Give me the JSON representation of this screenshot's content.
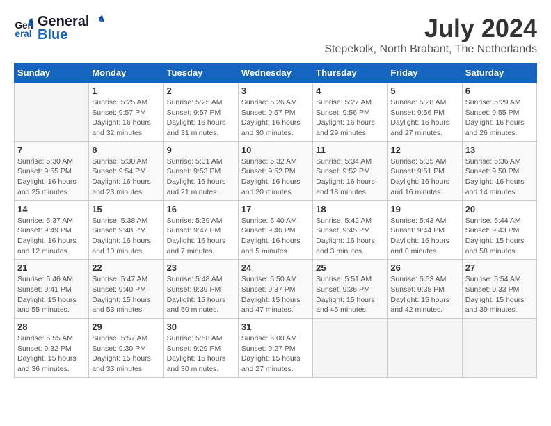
{
  "logo": {
    "text_general": "General",
    "text_blue": "Blue"
  },
  "header": {
    "month_year": "July 2024",
    "location": "Stepekolk, North Brabant, The Netherlands"
  },
  "weekdays": [
    "Sunday",
    "Monday",
    "Tuesday",
    "Wednesday",
    "Thursday",
    "Friday",
    "Saturday"
  ],
  "weeks": [
    [
      {
        "day": "",
        "sunrise": "",
        "sunset": "",
        "daylight": ""
      },
      {
        "day": "1",
        "sunrise": "Sunrise: 5:25 AM",
        "sunset": "Sunset: 9:57 PM",
        "daylight": "Daylight: 16 hours and 32 minutes."
      },
      {
        "day": "2",
        "sunrise": "Sunrise: 5:25 AM",
        "sunset": "Sunset: 9:57 PM",
        "daylight": "Daylight: 16 hours and 31 minutes."
      },
      {
        "day": "3",
        "sunrise": "Sunrise: 5:26 AM",
        "sunset": "Sunset: 9:57 PM",
        "daylight": "Daylight: 16 hours and 30 minutes."
      },
      {
        "day": "4",
        "sunrise": "Sunrise: 5:27 AM",
        "sunset": "Sunset: 9:56 PM",
        "daylight": "Daylight: 16 hours and 29 minutes."
      },
      {
        "day": "5",
        "sunrise": "Sunrise: 5:28 AM",
        "sunset": "Sunset: 9:56 PM",
        "daylight": "Daylight: 16 hours and 27 minutes."
      },
      {
        "day": "6",
        "sunrise": "Sunrise: 5:29 AM",
        "sunset": "Sunset: 9:55 PM",
        "daylight": "Daylight: 16 hours and 26 minutes."
      }
    ],
    [
      {
        "day": "7",
        "sunrise": "Sunrise: 5:30 AM",
        "sunset": "Sunset: 9:55 PM",
        "daylight": "Daylight: 16 hours and 25 minutes."
      },
      {
        "day": "8",
        "sunrise": "Sunrise: 5:30 AM",
        "sunset": "Sunset: 9:54 PM",
        "daylight": "Daylight: 16 hours and 23 minutes."
      },
      {
        "day": "9",
        "sunrise": "Sunrise: 5:31 AM",
        "sunset": "Sunset: 9:53 PM",
        "daylight": "Daylight: 16 hours and 21 minutes."
      },
      {
        "day": "10",
        "sunrise": "Sunrise: 5:32 AM",
        "sunset": "Sunset: 9:52 PM",
        "daylight": "Daylight: 16 hours and 20 minutes."
      },
      {
        "day": "11",
        "sunrise": "Sunrise: 5:34 AM",
        "sunset": "Sunset: 9:52 PM",
        "daylight": "Daylight: 16 hours and 18 minutes."
      },
      {
        "day": "12",
        "sunrise": "Sunrise: 5:35 AM",
        "sunset": "Sunset: 9:51 PM",
        "daylight": "Daylight: 16 hours and 16 minutes."
      },
      {
        "day": "13",
        "sunrise": "Sunrise: 5:36 AM",
        "sunset": "Sunset: 9:50 PM",
        "daylight": "Daylight: 16 hours and 14 minutes."
      }
    ],
    [
      {
        "day": "14",
        "sunrise": "Sunrise: 5:37 AM",
        "sunset": "Sunset: 9:49 PM",
        "daylight": "Daylight: 16 hours and 12 minutes."
      },
      {
        "day": "15",
        "sunrise": "Sunrise: 5:38 AM",
        "sunset": "Sunset: 9:48 PM",
        "daylight": "Daylight: 16 hours and 10 minutes."
      },
      {
        "day": "16",
        "sunrise": "Sunrise: 5:39 AM",
        "sunset": "Sunset: 9:47 PM",
        "daylight": "Daylight: 16 hours and 7 minutes."
      },
      {
        "day": "17",
        "sunrise": "Sunrise: 5:40 AM",
        "sunset": "Sunset: 9:46 PM",
        "daylight": "Daylight: 16 hours and 5 minutes."
      },
      {
        "day": "18",
        "sunrise": "Sunrise: 5:42 AM",
        "sunset": "Sunset: 9:45 PM",
        "daylight": "Daylight: 16 hours and 3 minutes."
      },
      {
        "day": "19",
        "sunrise": "Sunrise: 5:43 AM",
        "sunset": "Sunset: 9:44 PM",
        "daylight": "Daylight: 16 hours and 0 minutes."
      },
      {
        "day": "20",
        "sunrise": "Sunrise: 5:44 AM",
        "sunset": "Sunset: 9:43 PM",
        "daylight": "Daylight: 15 hours and 58 minutes."
      }
    ],
    [
      {
        "day": "21",
        "sunrise": "Sunrise: 5:46 AM",
        "sunset": "Sunset: 9:41 PM",
        "daylight": "Daylight: 15 hours and 55 minutes."
      },
      {
        "day": "22",
        "sunrise": "Sunrise: 5:47 AM",
        "sunset": "Sunset: 9:40 PM",
        "daylight": "Daylight: 15 hours and 53 minutes."
      },
      {
        "day": "23",
        "sunrise": "Sunrise: 5:48 AM",
        "sunset": "Sunset: 9:39 PM",
        "daylight": "Daylight: 15 hours and 50 minutes."
      },
      {
        "day": "24",
        "sunrise": "Sunrise: 5:50 AM",
        "sunset": "Sunset: 9:37 PM",
        "daylight": "Daylight: 15 hours and 47 minutes."
      },
      {
        "day": "25",
        "sunrise": "Sunrise: 5:51 AM",
        "sunset": "Sunset: 9:36 PM",
        "daylight": "Daylight: 15 hours and 45 minutes."
      },
      {
        "day": "26",
        "sunrise": "Sunrise: 5:53 AM",
        "sunset": "Sunset: 9:35 PM",
        "daylight": "Daylight: 15 hours and 42 minutes."
      },
      {
        "day": "27",
        "sunrise": "Sunrise: 5:54 AM",
        "sunset": "Sunset: 9:33 PM",
        "daylight": "Daylight: 15 hours and 39 minutes."
      }
    ],
    [
      {
        "day": "28",
        "sunrise": "Sunrise: 5:55 AM",
        "sunset": "Sunset: 9:32 PM",
        "daylight": "Daylight: 15 hours and 36 minutes."
      },
      {
        "day": "29",
        "sunrise": "Sunrise: 5:57 AM",
        "sunset": "Sunset: 9:30 PM",
        "daylight": "Daylight: 15 hours and 33 minutes."
      },
      {
        "day": "30",
        "sunrise": "Sunrise: 5:58 AM",
        "sunset": "Sunset: 9:29 PM",
        "daylight": "Daylight: 15 hours and 30 minutes."
      },
      {
        "day": "31",
        "sunrise": "Sunrise: 6:00 AM",
        "sunset": "Sunset: 9:27 PM",
        "daylight": "Daylight: 15 hours and 27 minutes."
      },
      {
        "day": "",
        "sunrise": "",
        "sunset": "",
        "daylight": ""
      },
      {
        "day": "",
        "sunrise": "",
        "sunset": "",
        "daylight": ""
      },
      {
        "day": "",
        "sunrise": "",
        "sunset": "",
        "daylight": ""
      }
    ]
  ]
}
